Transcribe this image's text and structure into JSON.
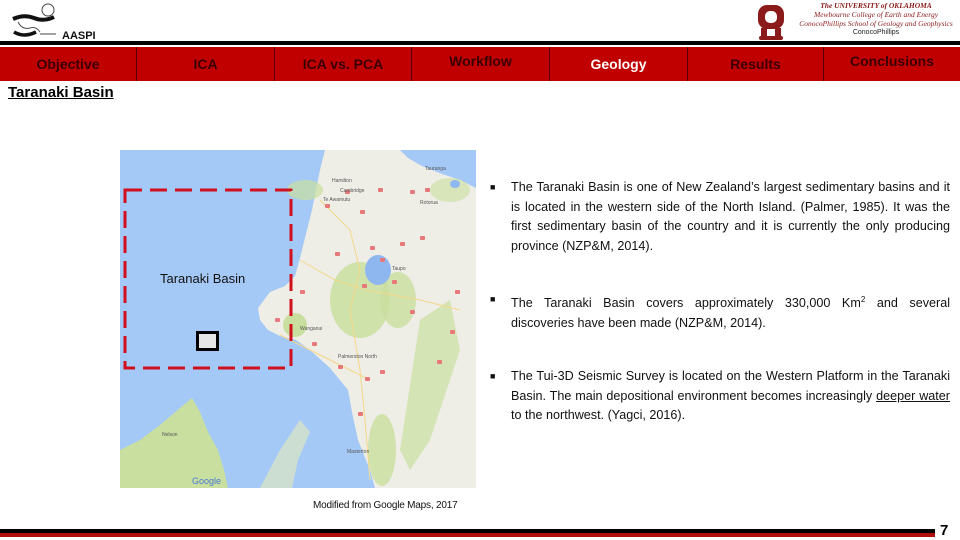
{
  "header": {
    "left_logo_icon": "aaspi-logo-icon",
    "left_logo_label": "AASPI",
    "right_logo_icon": "ou-logo-icon",
    "university_lines": [
      "The UNIVERSITY of OKLAHOMA",
      "Mewbourne College of Earth and Energy",
      "ConocoPhillips School of Geology and Geophysics",
      "ConocoPhillips"
    ]
  },
  "nav": {
    "items": [
      {
        "label": "Objective",
        "active": false
      },
      {
        "label": "ICA",
        "active": false
      },
      {
        "label": "ICA vs. PCA",
        "active": false
      },
      {
        "label": "Workflow",
        "active": false
      },
      {
        "label": "Geology",
        "active": true
      },
      {
        "label": "Results",
        "active": false
      },
      {
        "label": "Conclusions",
        "active": false
      }
    ]
  },
  "section_title": "Taranaki Basin",
  "map": {
    "basin_label": "Taranaki Basin",
    "google_watermark": "Google",
    "place_labels": [
      "Tauranga",
      "Hamilton",
      "Cambridge",
      "Te Awamutu",
      "Rotorua",
      "Taupo",
      "Palmerston North",
      "Wanganui",
      "Masterton",
      "Nelson"
    ],
    "caption": "Modified from Google Maps, 2017",
    "colors": {
      "sea": "#a5c9f7",
      "land": "#eeede6",
      "park": "#c9df9f",
      "basin_outline": "#d0101c",
      "lake": "#8fb7ef"
    }
  },
  "bullets": [
    {
      "marker": "■",
      "text": "The Taranaki Basin is one of New Zealand’s largest sedimentary basins and it is located in the western side of the North Island. (Palmer, 1985). It was the first sedimentary basin of the country and it is currently the only producing province (NZP&M, 2014)."
    },
    {
      "marker": "■",
      "text_before": "The Taranaki Basin covers approximately 330,000 Km",
      "superscript": "2",
      "text_after": " and several discoveries have been made (NZP&M, 2014)."
    },
    {
      "marker": "■",
      "text_before": "The Tui-3D Seismic Survey is located on the Western Platform in the Taranaki Basin. The main depositional environment becomes increasingly ",
      "underlined": "deeper water ",
      "text_after": "to the northwest. (Yagci, 2016)."
    }
  ],
  "footer": {
    "page_number": "7"
  },
  "colors": {
    "nav_bg": "#c00000",
    "nav_text": "#3a0000",
    "nav_active_text": "#ffffff",
    "rule_black": "#000000",
    "rule_red": "#b00d0d"
  }
}
